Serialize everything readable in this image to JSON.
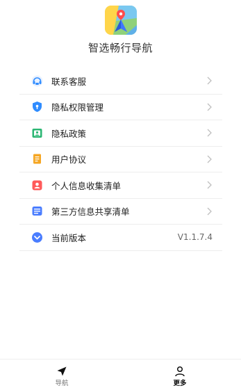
{
  "header": {
    "app_name": "智选畅行导航",
    "logo_icon": "map-navigation-logo-icon"
  },
  "menu": {
    "items": [
      {
        "label": "联系客服",
        "icon": "customer-service-icon",
        "color": "#2f8cff"
      },
      {
        "label": "隐私权限管理",
        "icon": "privacy-shield-icon",
        "color": "#2f8cff"
      },
      {
        "label": "隐私政策",
        "icon": "privacy-policy-icon",
        "color": "#2bb673"
      },
      {
        "label": "用户协议",
        "icon": "user-agreement-icon",
        "color": "#f5a623"
      },
      {
        "label": "个人信息收集清单",
        "icon": "personal-info-icon",
        "color": "#ff5a5a"
      },
      {
        "label": "第三方信息共享清单",
        "icon": "third-party-share-icon",
        "color": "#4a7dff"
      },
      {
        "label": "当前版本",
        "icon": "version-icon",
        "color": "#4a7dff"
      }
    ],
    "version_value": "V1.1.7.4"
  },
  "tabbar": {
    "tabs": [
      {
        "label": "导航",
        "icon": "navigation-arrow-icon",
        "active": false
      },
      {
        "label": "更多",
        "icon": "person-icon",
        "active": true
      }
    ]
  }
}
